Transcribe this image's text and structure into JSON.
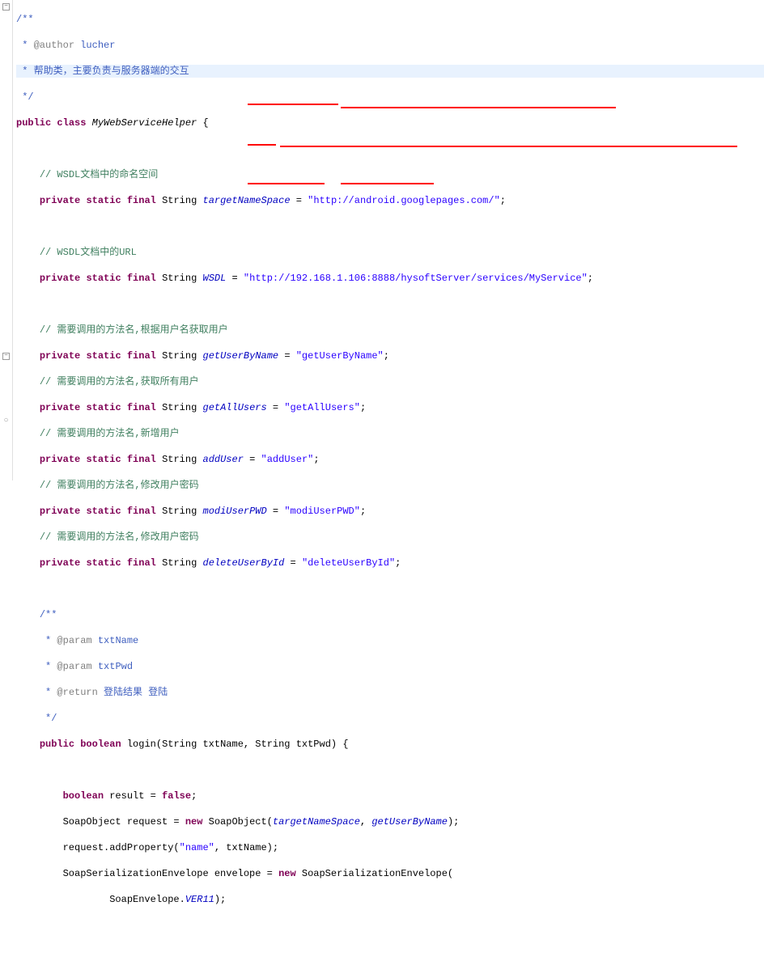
{
  "gutter": {
    "fold_minus": "−",
    "fold_circle": "○"
  },
  "jd": {
    "author_tag": "@author",
    "author_name": "lucher",
    "desc": "帮助类，主要负责与服务器端的交互",
    "param_tag": "@param",
    "param1": "txtName",
    "param2": "txtPwd",
    "return_tag": "@return",
    "return_desc": "登陆结果 登陆"
  },
  "cls": {
    "public": "public",
    "class_kw": "class",
    "name": "MyWebServiceHelper",
    "open": "{"
  },
  "mod": {
    "private": "private",
    "static": "static",
    "final": "final",
    "String": "String",
    "new": "new",
    "boolean": "boolean",
    "false": "false"
  },
  "c": {
    "namespace": "// WSDL文档中的命名空间",
    "wsdl": "// WSDL文档中的URL",
    "m1": "// 需要调用的方法名,根据用户名获取用户",
    "m2": "// 需要调用的方法名,获取所有用户",
    "m3": "// 需要调用的方法名,新增用户",
    "m4": "// 需要调用的方法名,修改用户密码",
    "m5": "// 需要调用的方法名,修改用户密码"
  },
  "f": {
    "targetNameSpace": "targetNameSpace",
    "targetNameSpace_val": "\"http://android.googlepages.com/\"",
    "WSDL": "WSDL",
    "WSDL_val": "\"http://192.168.1.106:8888/hysoftServer/services/MyService\"",
    "getUserByName": "getUserByName",
    "getUserByName_val": "\"getUserByName\"",
    "getAllUsers": "getAllUsers",
    "getAllUsers_val": "\"getAllUsers\"",
    "addUser": "addUser",
    "addUser_val": "\"addUser\"",
    "modiUserPWD": "modiUserPWD",
    "modiUserPWD_val": "\"modiUserPWD\"",
    "deleteUserById": "deleteUserById",
    "deleteUserById_val": "\"deleteUserById\""
  },
  "m": {
    "public": "public",
    "boolean": "boolean",
    "login": "login",
    "params": "(String txtName, String txtPwd) {"
  },
  "body": {
    "l1a": "boolean",
    "l1b": " result = ",
    "l1c": "false",
    "l1d": ";",
    "l2a": "SoapObject request = ",
    "l2b": "new",
    "l2c": " SoapObject(",
    "l2d": "targetNameSpace",
    "l2e": ", ",
    "l2f": "getUserByName",
    "l2g": ");",
    "l3a": "request.addProperty(",
    "l3b": "\"name\"",
    "l3c": ", txtName);",
    "l4a": "SoapSerializationEnvelope envelope = ",
    "l4b": "new",
    "l4c": " SoapSerializationEnvelope(",
    "l5a": "SoapEnvelope.",
    "l5b": "VER11",
    "l5c": ");"
  },
  "pre": "/**",
  "star": " * ",
  "end": " */",
  "eq": " = ",
  "sc": ";"
}
